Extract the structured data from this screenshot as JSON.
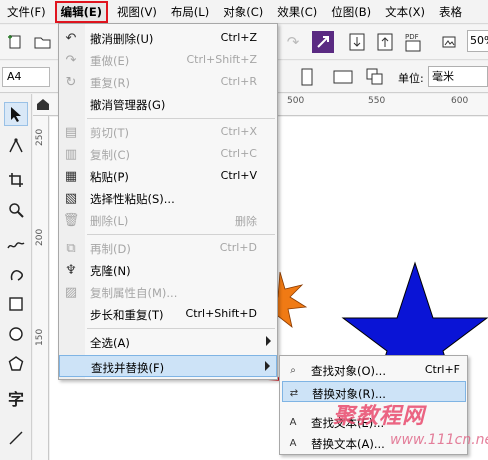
{
  "menubar": {
    "items": [
      {
        "label": "文件(F)"
      },
      {
        "label": "编辑(E)"
      },
      {
        "label": "视图(V)"
      },
      {
        "label": "布局(L)"
      },
      {
        "label": "对象(C)"
      },
      {
        "label": "效果(C)"
      },
      {
        "label": "位图(B)"
      },
      {
        "label": "文本(X)"
      },
      {
        "label": "表格"
      }
    ]
  },
  "toolbar2": {
    "page_size": "A4",
    "unit_label": "单位:",
    "unit_value": "毫米"
  },
  "toolbar1": {
    "zoom": "50%"
  },
  "ruler": {
    "h_labels": [
      "500",
      "550",
      "600"
    ],
    "v_labels": [
      "250",
      "200",
      "150"
    ]
  },
  "edit_menu": {
    "items": [
      {
        "label": "撤消删除(U)",
        "shortcut": "Ctrl+Z",
        "disabled": false,
        "icon": "undo-icon"
      },
      {
        "label": "重做(E)",
        "shortcut": "Ctrl+Shift+Z",
        "disabled": true,
        "icon": "redo-icon"
      },
      {
        "label": "重复(R)",
        "shortcut": "Ctrl+R",
        "disabled": true,
        "icon": "repeat-icon"
      },
      {
        "label": "撤消管理器(G)",
        "shortcut": "",
        "disabled": false,
        "icon": ""
      },
      {
        "label": "剪切(T)",
        "shortcut": "Ctrl+X",
        "disabled": true,
        "icon": "cut-icon"
      },
      {
        "label": "复制(C)",
        "shortcut": "Ctrl+C",
        "disabled": true,
        "icon": "copy-icon"
      },
      {
        "label": "粘贴(P)",
        "shortcut": "Ctrl+V",
        "disabled": false,
        "icon": "paste-icon"
      },
      {
        "label": "选择性粘贴(S)...",
        "shortcut": "",
        "disabled": false,
        "icon": "paste-special-icon"
      },
      {
        "label": "删除(L)",
        "shortcut": "删除",
        "disabled": true,
        "icon": "trash-icon"
      },
      {
        "label": "再制(D)",
        "shortcut": "Ctrl+D",
        "disabled": true,
        "icon": "duplicate-icon"
      },
      {
        "label": "克隆(N)",
        "shortcut": "",
        "disabled": false,
        "icon": "clone-icon"
      },
      {
        "label": "复制属性自(M)...",
        "shortcut": "",
        "disabled": true,
        "icon": "copy-properties-icon"
      },
      {
        "label": "步长和重复(T)",
        "shortcut": "Ctrl+Shift+D",
        "disabled": false,
        "icon": ""
      },
      {
        "label": "全选(A)",
        "shortcut": "",
        "disabled": false,
        "icon": ""
      },
      {
        "label": "查找并替换(F)",
        "shortcut": "",
        "disabled": false,
        "icon": ""
      }
    ]
  },
  "find_replace_submenu": {
    "items": [
      {
        "label": "查找对象(O)...",
        "shortcut": "Ctrl+F",
        "icon": "find-objects-icon"
      },
      {
        "label": "替换对象(R)...",
        "shortcut": "",
        "icon": "replace-objects-icon"
      },
      {
        "label": "查找文本(E)...",
        "shortcut": "",
        "icon": "find-text-icon"
      },
      {
        "label": "替换文本(A)...",
        "shortcut": "",
        "icon": "replace-text-icon"
      }
    ]
  },
  "watermark": {
    "line1": "聚教程网",
    "line2": "www.111cn.net"
  },
  "colors": {
    "highlight_border": "#e0141e",
    "star_blue": "#0a14d6",
    "star_orange": "#f07a14",
    "menu_hover": "#cde3f7",
    "arrow_red": "#e0141e"
  }
}
